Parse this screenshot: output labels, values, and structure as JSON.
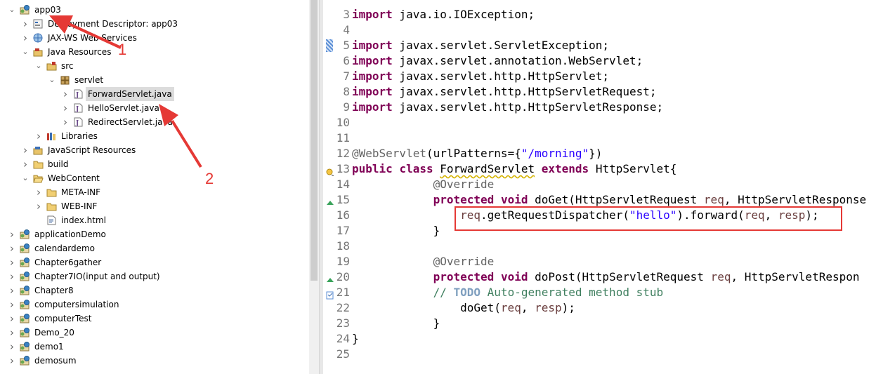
{
  "explorer": {
    "items": [
      {
        "label": "app03",
        "depth": 0,
        "expanded": true,
        "icon": "project-icon"
      },
      {
        "label": "Deployment Descriptor: app03",
        "depth": 1,
        "expanded": false,
        "icon": "deployment-descriptor-icon"
      },
      {
        "label": "JAX-WS Web Services",
        "depth": 1,
        "expanded": false,
        "icon": "web-services-icon"
      },
      {
        "label": "Java Resources",
        "depth": 1,
        "expanded": true,
        "icon": "java-resources-icon"
      },
      {
        "label": "src",
        "depth": 2,
        "expanded": true,
        "icon": "source-folder-icon"
      },
      {
        "label": "servlet",
        "depth": 3,
        "expanded": true,
        "icon": "package-icon"
      },
      {
        "label": "ForwardServlet.java",
        "depth": 4,
        "expanded": false,
        "icon": "java-file-icon",
        "selected": true
      },
      {
        "label": "HelloServlet.java",
        "depth": 4,
        "expanded": false,
        "icon": "java-file-icon"
      },
      {
        "label": "RedirectServlet.java",
        "depth": 4,
        "expanded": false,
        "icon": "java-file-icon"
      },
      {
        "label": "Libraries",
        "depth": 2,
        "expanded": false,
        "icon": "libraries-icon"
      },
      {
        "label": "JavaScript Resources",
        "depth": 1,
        "expanded": false,
        "icon": "javascript-resources-icon"
      },
      {
        "label": "build",
        "depth": 1,
        "expanded": false,
        "icon": "folder-icon"
      },
      {
        "label": "WebContent",
        "depth": 1,
        "expanded": true,
        "icon": "folder-open-icon"
      },
      {
        "label": "META-INF",
        "depth": 2,
        "expanded": false,
        "icon": "folder-icon"
      },
      {
        "label": "WEB-INF",
        "depth": 2,
        "expanded": false,
        "icon": "folder-icon"
      },
      {
        "label": "index.html",
        "depth": 2,
        "leaf": true,
        "icon": "html-file-icon"
      },
      {
        "label": "applicationDemo",
        "depth": 0,
        "expanded": false,
        "icon": "project-icon"
      },
      {
        "label": "calendardemo",
        "depth": 0,
        "expanded": false,
        "icon": "project-icon"
      },
      {
        "label": "Chapter6gather",
        "depth": 0,
        "expanded": false,
        "icon": "project-icon"
      },
      {
        "label": "Chapter7IO(input and output)",
        "depth": 0,
        "expanded": false,
        "icon": "project-icon"
      },
      {
        "label": "Chapter8",
        "depth": 0,
        "expanded": false,
        "icon": "project-icon"
      },
      {
        "label": "computersimulation",
        "depth": 0,
        "expanded": false,
        "icon": "project-icon"
      },
      {
        "label": "computerTest",
        "depth": 0,
        "expanded": false,
        "icon": "project-icon"
      },
      {
        "label": "Demo_20",
        "depth": 0,
        "expanded": false,
        "icon": "project-icon"
      },
      {
        "label": "demo1",
        "depth": 0,
        "expanded": false,
        "icon": "project-icon"
      },
      {
        "label": "demosum",
        "depth": 0,
        "expanded": false,
        "icon": "project-icon"
      }
    ]
  },
  "editor": {
    "lines": [
      {
        "n": "3",
        "tokens": [
          {
            "t": "import",
            "c": "kw"
          },
          {
            "t": " java.io.IOException;"
          }
        ]
      },
      {
        "n": "4",
        "tokens": []
      },
      {
        "n": "5",
        "marker": "change",
        "tokens": [
          {
            "t": "import",
            "c": "kw"
          },
          {
            "t": " javax.servlet.ServletException;"
          }
        ]
      },
      {
        "n": "6",
        "tokens": [
          {
            "t": "import",
            "c": "kw"
          },
          {
            "t": " javax.servlet.annotation.WebServlet;"
          }
        ]
      },
      {
        "n": "7",
        "tokens": [
          {
            "t": "import",
            "c": "kw"
          },
          {
            "t": " javax.servlet.http.HttpServlet;"
          }
        ]
      },
      {
        "n": "8",
        "tokens": [
          {
            "t": "import",
            "c": "kw"
          },
          {
            "t": " javax.servlet.http.HttpServletRequest;"
          }
        ]
      },
      {
        "n": "9",
        "tokens": [
          {
            "t": "import",
            "c": "kw"
          },
          {
            "t": " javax.servlet.http.HttpServletResponse;"
          }
        ]
      },
      {
        "n": "10",
        "tokens": []
      },
      {
        "n": "11",
        "tokens": []
      },
      {
        "n": "12",
        "tokens": [
          {
            "t": "@WebServlet",
            "c": "ann"
          },
          {
            "t": "(urlPatterns={"
          },
          {
            "t": "\"/morning\"",
            "c": "str"
          },
          {
            "t": "})"
          }
        ]
      },
      {
        "n": "13",
        "marker": "warning",
        "tokens": [
          {
            "t": "public",
            "c": "kw"
          },
          {
            "t": " "
          },
          {
            "t": "class",
            "c": "kw"
          },
          {
            "t": " "
          },
          {
            "t": "ForwardServlet",
            "c": "squig"
          },
          {
            "t": " "
          },
          {
            "t": "extends",
            "c": "kw"
          },
          {
            "t": " HttpServlet{"
          }
        ]
      },
      {
        "n": "14",
        "tokens": [
          {
            "t": "            "
          },
          {
            "t": "@Override",
            "c": "ann"
          }
        ]
      },
      {
        "n": "15",
        "marker": "override",
        "tokens": [
          {
            "t": "            "
          },
          {
            "t": "protected",
            "c": "kw"
          },
          {
            "t": " "
          },
          {
            "t": "void",
            "c": "kw"
          },
          {
            "t": " doGet(HttpServletRequest "
          },
          {
            "t": "req",
            "c": "var"
          },
          {
            "t": ", HttpServletResponse"
          }
        ]
      },
      {
        "n": "16",
        "tokens": [
          {
            "t": "                "
          },
          {
            "t": "req",
            "c": "var"
          },
          {
            "t": ".getRequestDispatcher("
          },
          {
            "t": "\"hello\"",
            "c": "str"
          },
          {
            "t": ").forward("
          },
          {
            "t": "req",
            "c": "var"
          },
          {
            "t": ", "
          },
          {
            "t": "resp",
            "c": "var"
          },
          {
            "t": ");"
          }
        ]
      },
      {
        "n": "17",
        "tokens": [
          {
            "t": "            }"
          }
        ]
      },
      {
        "n": "18",
        "tokens": []
      },
      {
        "n": "19",
        "tokens": [
          {
            "t": "            "
          },
          {
            "t": "@Override",
            "c": "ann"
          }
        ]
      },
      {
        "n": "20",
        "marker": "override",
        "tokens": [
          {
            "t": "            "
          },
          {
            "t": "protected",
            "c": "kw"
          },
          {
            "t": " "
          },
          {
            "t": "void",
            "c": "kw"
          },
          {
            "t": " doPost(HttpServletRequest "
          },
          {
            "t": "req",
            "c": "var"
          },
          {
            "t": ", HttpServletRespon"
          }
        ]
      },
      {
        "n": "21",
        "marker": "task",
        "tokens": [
          {
            "t": "            "
          },
          {
            "t": "// ",
            "c": "cmt"
          },
          {
            "t": "TODO",
            "c": "todo"
          },
          {
            "t": " Auto-generated method stub",
            "c": "cmt"
          }
        ]
      },
      {
        "n": "22",
        "tokens": [
          {
            "t": "                doGet("
          },
          {
            "t": "req",
            "c": "var"
          },
          {
            "t": ", "
          },
          {
            "t": "resp",
            "c": "var"
          },
          {
            "t": ");"
          }
        ]
      },
      {
        "n": "23",
        "tokens": [
          {
            "t": "            }"
          }
        ]
      },
      {
        "n": "24",
        "tokens": [
          {
            "t": "}"
          }
        ]
      },
      {
        "n": "25",
        "tokens": []
      }
    ]
  },
  "annotations": {
    "label1": "1",
    "label2": "2",
    "color": "#e53935"
  }
}
